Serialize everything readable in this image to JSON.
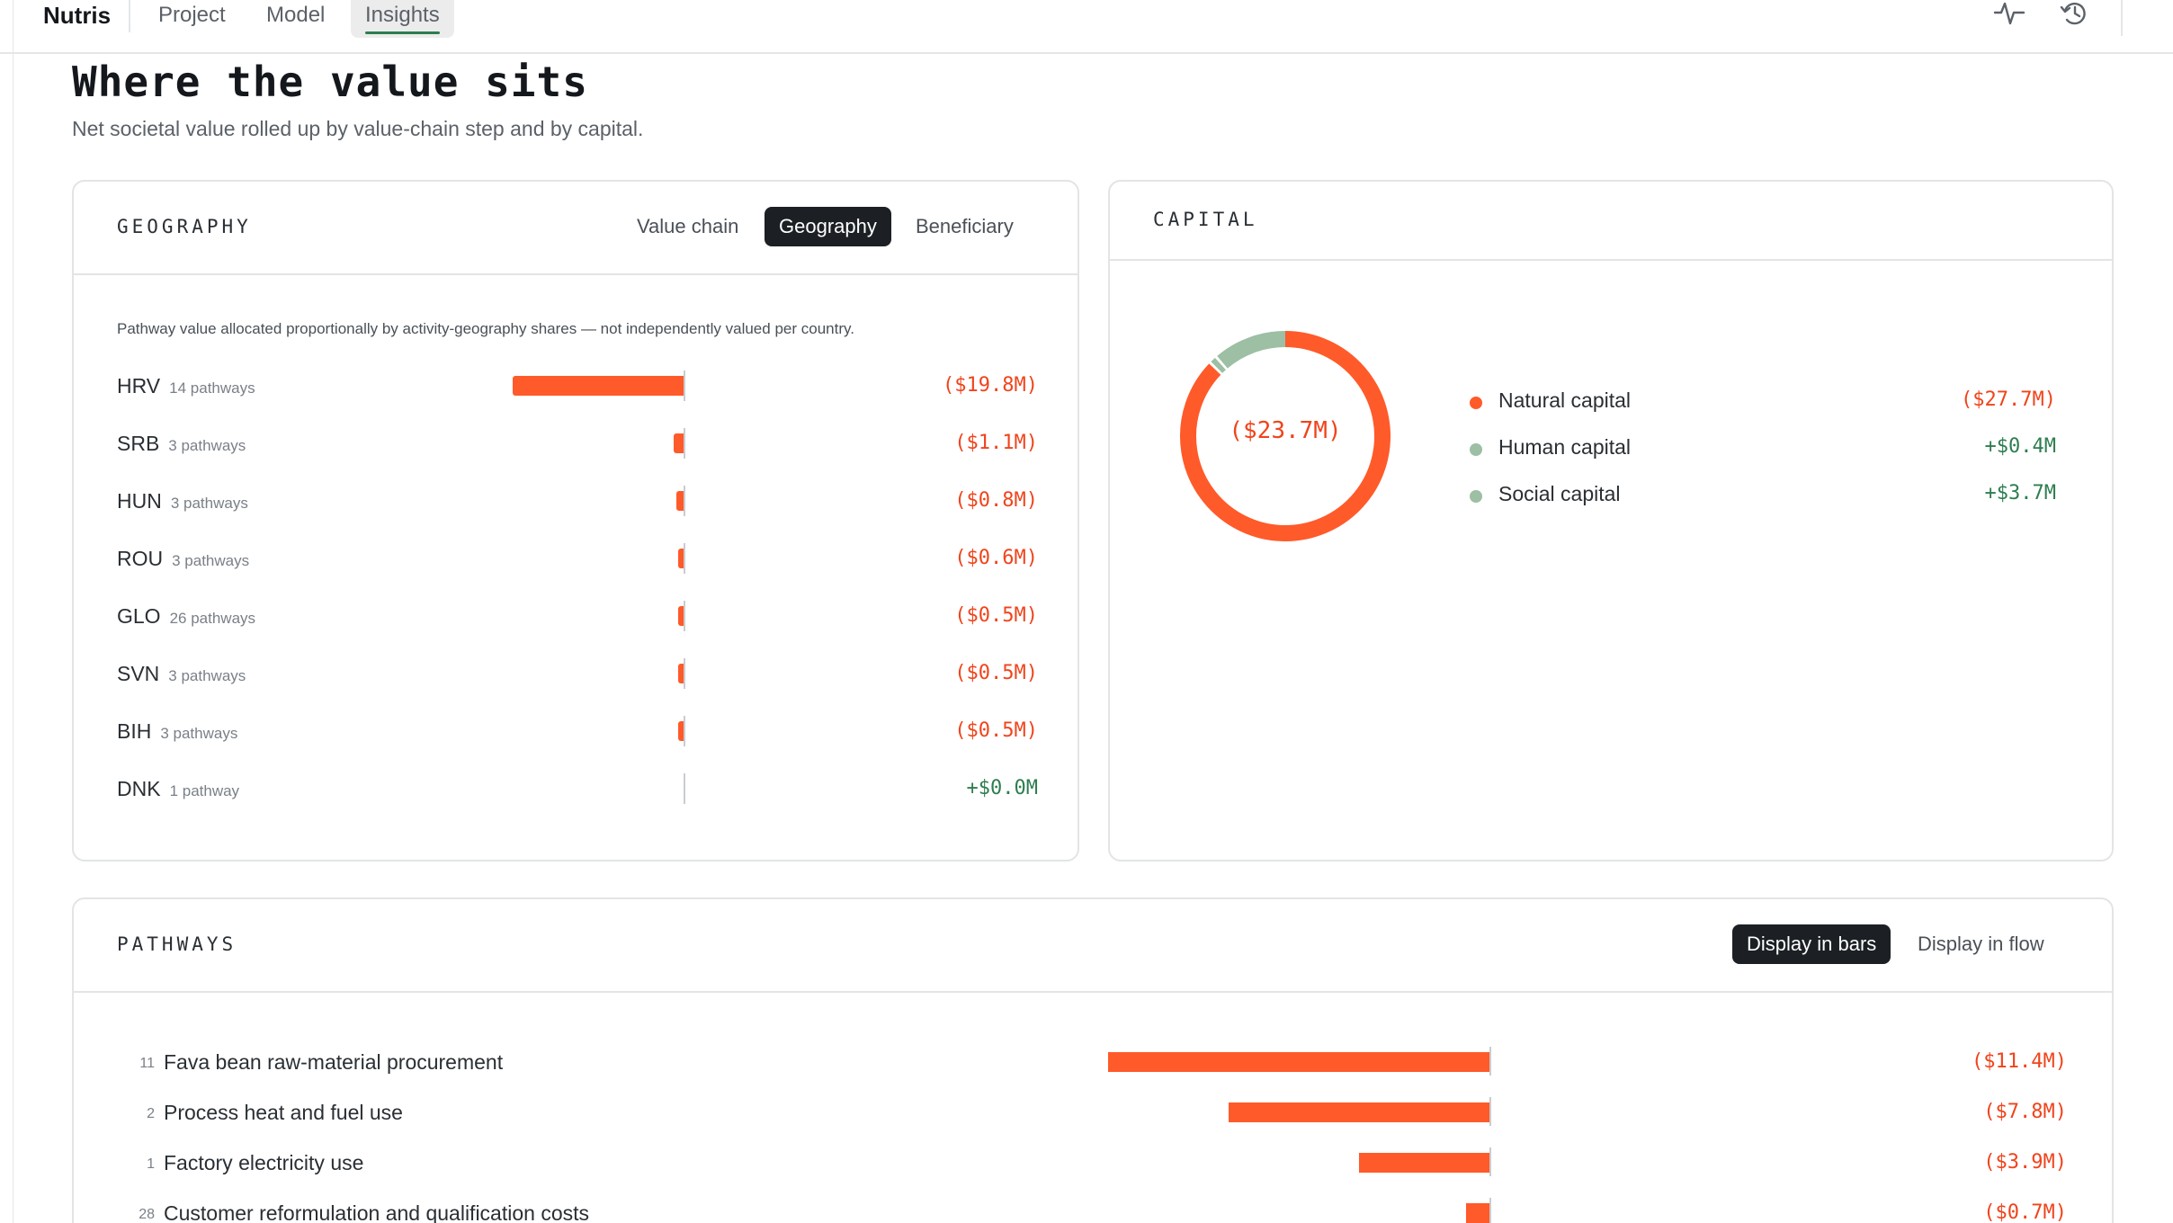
{
  "app": {
    "brand": "Nutris",
    "nav": [
      {
        "label": "Project",
        "active": false
      },
      {
        "label": "Model",
        "active": false
      },
      {
        "label": "Insights",
        "active": true
      }
    ],
    "icons": [
      "activity-icon",
      "history-icon"
    ]
  },
  "header": {
    "title": "Where the value sits",
    "subtitle": "Net societal value rolled up by value-chain step and by capital."
  },
  "geography_card": {
    "title": "GEOGRAPHY",
    "tabs": [
      {
        "label": "Value chain",
        "active": false
      },
      {
        "label": "Geography",
        "active": true
      },
      {
        "label": "Beneficiary",
        "active": false
      }
    ],
    "note": "Pathway value allocated proportionally by activity-geography shares — not independently valued per country.",
    "rows": [
      {
        "code": "HRV",
        "count": "14 pathways",
        "value": "($19.8M)",
        "amount": -19.8
      },
      {
        "code": "SRB",
        "count": "3 pathways",
        "value": "($1.1M)",
        "amount": -1.1
      },
      {
        "code": "HUN",
        "count": "3 pathways",
        "value": "($0.8M)",
        "amount": -0.8
      },
      {
        "code": "ROU",
        "count": "3 pathways",
        "value": "($0.6M)",
        "amount": -0.6
      },
      {
        "code": "GLO",
        "count": "26 pathways",
        "value": "($0.5M)",
        "amount": -0.5
      },
      {
        "code": "SVN",
        "count": "3 pathways",
        "value": "($0.5M)",
        "amount": -0.5
      },
      {
        "code": "BIH",
        "count": "3 pathways",
        "value": "($0.5M)",
        "amount": -0.5
      },
      {
        "code": "DNK",
        "count": "1 pathway",
        "value": "+$0.0M",
        "amount": 0.0
      }
    ]
  },
  "capital_card": {
    "title": "CAPITAL",
    "total": "($23.7M)",
    "items": [
      {
        "label": "Natural capital",
        "value": "($27.7M)",
        "amount": -27.7,
        "color": "#ff5a2a"
      },
      {
        "label": "Human capital",
        "value": "+$0.4M",
        "amount": 0.4,
        "color": "#9dbfa4"
      },
      {
        "label": "Social capital",
        "value": "+$3.7M",
        "amount": 3.7,
        "color": "#9dbfa4"
      }
    ]
  },
  "pathways_card": {
    "title": "PATHWAYS",
    "toggles": [
      {
        "label": "Display in bars",
        "active": true
      },
      {
        "label": "Display in flow",
        "active": false
      }
    ],
    "rows": [
      {
        "id": "11",
        "label": "Fava bean raw-material procurement",
        "value": "($11.4M)",
        "amount": -11.4
      },
      {
        "id": "2",
        "label": "Process heat and fuel use",
        "value": "($7.8M)",
        "amount": -7.8
      },
      {
        "id": "1",
        "label": "Factory electricity use",
        "value": "($3.9M)",
        "amount": -3.9
      },
      {
        "id": "28",
        "label": "Customer reformulation and qualification costs",
        "value": "($0.7M)",
        "amount": -0.7
      }
    ]
  },
  "colors": {
    "negative": "#f0441c",
    "positive": "#2e7d4f",
    "bar": "#ff5a2a",
    "accent_underline": "#2e7d4f"
  }
}
